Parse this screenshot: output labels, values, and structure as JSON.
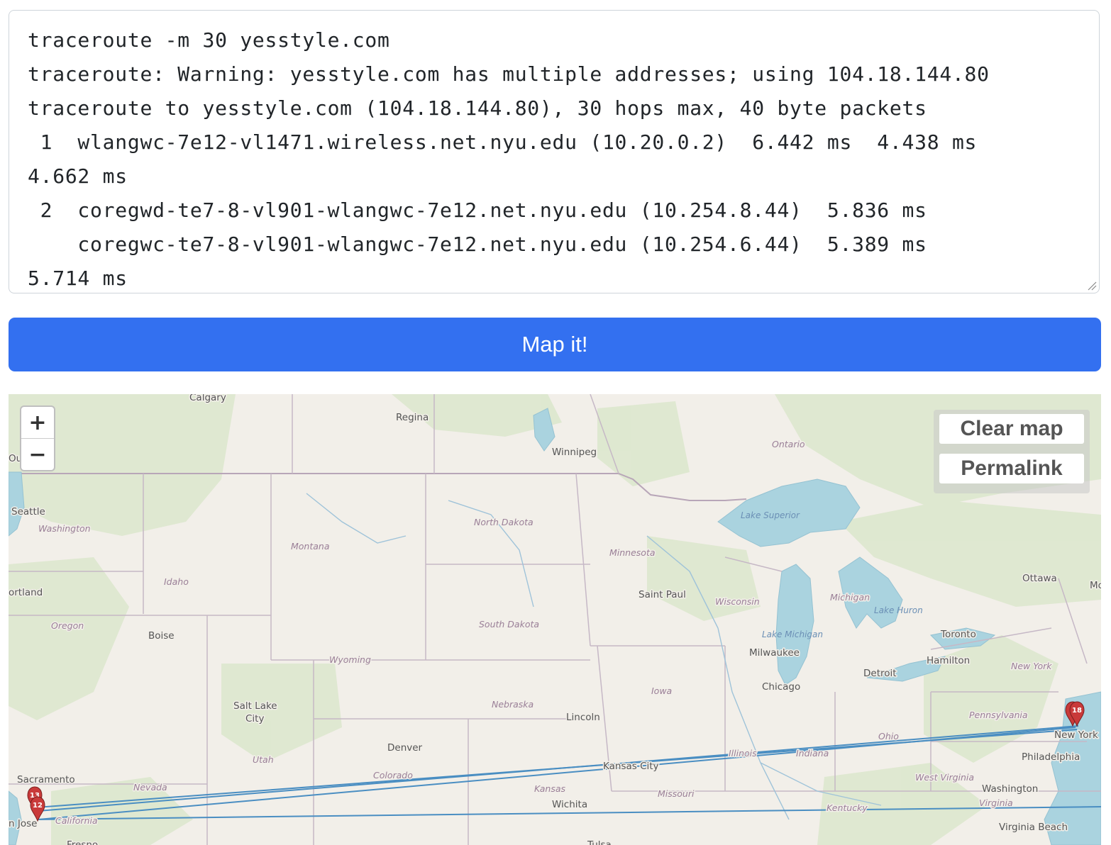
{
  "traceroute": {
    "lines": [
      "traceroute -m 30 yesstyle.com",
      "traceroute: Warning: yesstyle.com has multiple addresses; using 104.18.144.80",
      "traceroute to yesstyle.com (104.18.144.80), 30 hops max, 40 byte packets",
      " 1  wlangwc-7e12-vl1471.wireless.net.nyu.edu (10.20.0.2)  6.442 ms  4.438 ms",
      "4.662 ms",
      " 2  coregwd-te7-8-vl901-wlangwc-7e12.net.nyu.edu (10.254.8.44)  5.836 ms",
      "    coregwc-te7-8-vl901-wlangwc-7e12.net.nyu.edu (10.254.6.44)  5.389 ms",
      "5.714 ms"
    ]
  },
  "map_button": {
    "label": "Map it!"
  },
  "map": {
    "zoom_in": "+",
    "zoom_out": "−",
    "controls": {
      "clear": "Clear map",
      "permalink": "Permalink"
    },
    "cities": [
      {
        "name": "Calgary"
      },
      {
        "name": "Regina"
      },
      {
        "name": "Winnipeg"
      },
      {
        "name": "Seattle"
      },
      {
        "name": "ortland"
      },
      {
        "name": "Boise"
      },
      {
        "name": "Saint Paul"
      },
      {
        "name": "Milwaukee"
      },
      {
        "name": "Chicago"
      },
      {
        "name": "Detroit"
      },
      {
        "name": "Toronto"
      },
      {
        "name": "Hamilton"
      },
      {
        "name": "Ottawa"
      },
      {
        "name": "Salt Lake"
      },
      {
        "name": "City"
      },
      {
        "name": "Denver"
      },
      {
        "name": "Lincoln"
      },
      {
        "name": "Kansas City"
      },
      {
        "name": "Wichita"
      },
      {
        "name": "Sacramento"
      },
      {
        "name": "n Jose"
      },
      {
        "name": "New York"
      },
      {
        "name": "Philadelphia"
      },
      {
        "name": "Washington"
      },
      {
        "name": "Virginia Beach"
      },
      {
        "name": "Ou"
      },
      {
        "name": "Fresno"
      },
      {
        "name": "Tulsa"
      },
      {
        "name": "Mo"
      }
    ],
    "states": [
      {
        "name": "Washington"
      },
      {
        "name": "Montana"
      },
      {
        "name": "North Dakota"
      },
      {
        "name": "Minnesota"
      },
      {
        "name": "Idaho"
      },
      {
        "name": "Oregon"
      },
      {
        "name": "South Dakota"
      },
      {
        "name": "Wisconsin"
      },
      {
        "name": "Michigan"
      },
      {
        "name": "Wyoming"
      },
      {
        "name": "Iowa"
      },
      {
        "name": "Nebraska"
      },
      {
        "name": "Utah"
      },
      {
        "name": "Colorado"
      },
      {
        "name": "Nevada"
      },
      {
        "name": "Kansas"
      },
      {
        "name": "Missouri"
      },
      {
        "name": "Illinois"
      },
      {
        "name": "Indiana"
      },
      {
        "name": "Ohio"
      },
      {
        "name": "Pennsylvania"
      },
      {
        "name": "New York"
      },
      {
        "name": "West Virginia"
      },
      {
        "name": "Kentucky"
      },
      {
        "name": "Virginia"
      },
      {
        "name": "California"
      },
      {
        "name": "Ontario"
      }
    ],
    "water": [
      {
        "name": "Lake Superior"
      },
      {
        "name": "Lake Michigan"
      },
      {
        "name": "Lake Huron"
      }
    ],
    "markers": [
      "13",
      "12",
      "18"
    ],
    "route_color": "#4a8ec2",
    "marker_color": "#c93a3a"
  }
}
